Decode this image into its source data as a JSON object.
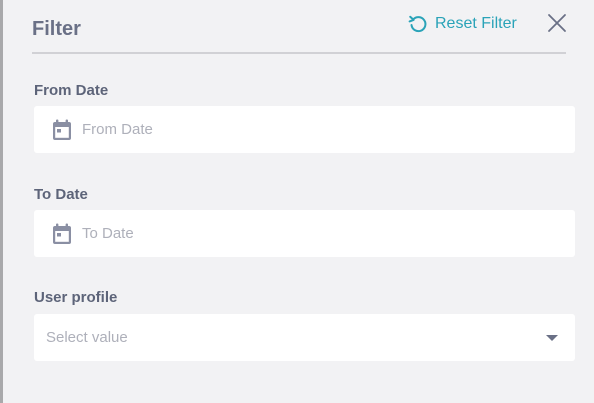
{
  "header": {
    "title": "Filter",
    "reset_label": "Reset Filter",
    "reset_icon": "reset-icon",
    "close_icon": "close-icon"
  },
  "fields": {
    "from_date": {
      "label": "From Date",
      "placeholder": "From Date",
      "icon": "calendar-icon"
    },
    "to_date": {
      "label": "To Date",
      "placeholder": "To Date",
      "icon": "calendar-icon"
    },
    "user_profile": {
      "label": "User profile",
      "placeholder": "Select value",
      "icon": "caret-down-icon"
    }
  },
  "colors": {
    "accent": "#2aa3b8",
    "label": "#5d6479",
    "title": "#6a7086",
    "placeholder": "#aeb0ba",
    "background": "#f2f2f4"
  }
}
